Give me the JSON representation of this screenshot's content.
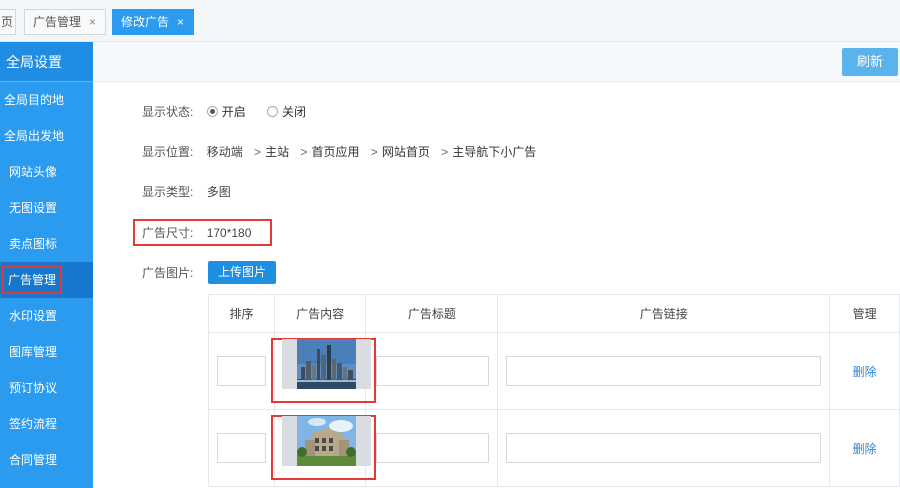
{
  "tabs": [
    {
      "label": "页",
      "closable": false
    },
    {
      "label": "广告管理",
      "closable": true
    },
    {
      "label": "修改广告",
      "closable": true,
      "active": true
    }
  ],
  "tab_close_glyph": "×",
  "sidebar": {
    "title": "全局设置",
    "items": [
      {
        "label": "全局目的地"
      },
      {
        "label": "全局出发地"
      },
      {
        "label": "网站头像"
      },
      {
        "label": "无图设置"
      },
      {
        "label": "卖点图标"
      },
      {
        "label": "广告管理",
        "active": true
      },
      {
        "label": "水印设置"
      },
      {
        "label": "图库管理"
      },
      {
        "label": "预订协议"
      },
      {
        "label": "签约流程"
      },
      {
        "label": "合同管理"
      }
    ]
  },
  "header": {
    "refresh_label": "刷新"
  },
  "form": {
    "status_label": "显示状态:",
    "status_on": "开启",
    "status_off": "关闭",
    "status_value": "开启",
    "position_label": "显示位置:",
    "position_path": [
      "移动端",
      "主站",
      "首页应用",
      "网站首页",
      "主导航下小广告"
    ],
    "path_separator": ">",
    "type_label": "显示类型:",
    "type_value": "多图",
    "size_label": "广告尺寸:",
    "size_value": "170*180",
    "image_label": "广告图片:",
    "upload_label": "上传图片"
  },
  "table": {
    "headers": [
      "排序",
      "广告内容",
      "广告标题",
      "广告链接",
      "管理"
    ],
    "rows": [
      {
        "order": "",
        "image": "city-skyline-thumbnail",
        "title": "",
        "link": "",
        "action": "删除"
      },
      {
        "order": "",
        "image": "building-thumbnail",
        "title": "",
        "link": "",
        "action": "删除"
      }
    ]
  },
  "colors": {
    "accent": "#2b9bf0",
    "highlight": "#e53935",
    "link": "#2b87d8"
  }
}
